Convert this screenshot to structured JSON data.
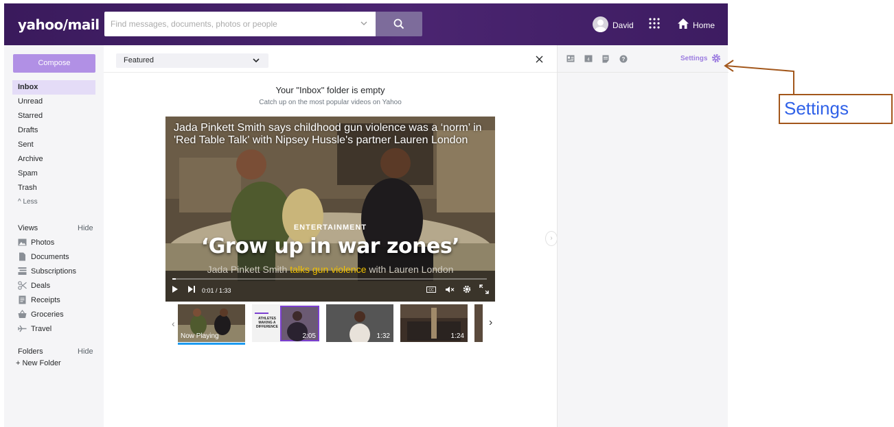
{
  "header": {
    "logo": "yahoo/mail",
    "search_placeholder": "Find messages, documents, photos or people",
    "user_name": "David",
    "home_label": "Home"
  },
  "sidebar": {
    "compose_label": "Compose",
    "folders": [
      "Inbox",
      "Unread",
      "Starred",
      "Drafts",
      "Sent",
      "Archive",
      "Spam",
      "Trash"
    ],
    "active_folder": "Inbox",
    "less_label": "^ Less",
    "views_title": "Views",
    "views_hide": "Hide",
    "views": [
      {
        "label": "Photos",
        "icon": "photos-icon"
      },
      {
        "label": "Documents",
        "icon": "documents-icon"
      },
      {
        "label": "Subscriptions",
        "icon": "subscriptions-icon"
      },
      {
        "label": "Deals",
        "icon": "scissors-icon"
      },
      {
        "label": "Receipts",
        "icon": "receipts-icon"
      },
      {
        "label": "Groceries",
        "icon": "basket-icon"
      },
      {
        "label": "Travel",
        "icon": "plane-icon"
      }
    ],
    "folders_title": "Folders",
    "folders_hide": "Hide",
    "new_folder": "+ New Folder"
  },
  "main": {
    "filter_label": "Featured",
    "empty_title": "Your \"Inbox\" folder is empty",
    "empty_subtitle": "Catch up on the most popular videos on Yahoo",
    "video": {
      "caption": "Jada Pinkett Smith says childhood gun violence was a ‘norm’ in 'Red Table Talk' with Nipsey Hussle's partner Lauren London",
      "category": "ENTERTAINMENT",
      "headline": "‘Grow up in war zones’",
      "sub_a": "Jada Pinkett Smith",
      "sub_b": "talks gun violence",
      "sub_c": "with Lauren London",
      "time": "0:01 / 1:33",
      "progress": 0.01
    },
    "thumbnails": [
      {
        "label": "Now Playing"
      },
      {
        "label": "2:05"
      },
      {
        "label": "1:32"
      },
      {
        "label": "1:24"
      }
    ],
    "thumb2_text": "ATHLETES MAKING A DIFFERENCE"
  },
  "right": {
    "settings_label": "Settings"
  },
  "annotation": {
    "label": "Settings"
  },
  "colors": {
    "header_bg": "#3a1a5c",
    "compose_bg": "#b190e5",
    "active_folder_bg": "#e4dcf7",
    "settings_text": "#9c7ce0",
    "annotation_border": "#a2561a",
    "annotation_text": "#2f61e8"
  }
}
